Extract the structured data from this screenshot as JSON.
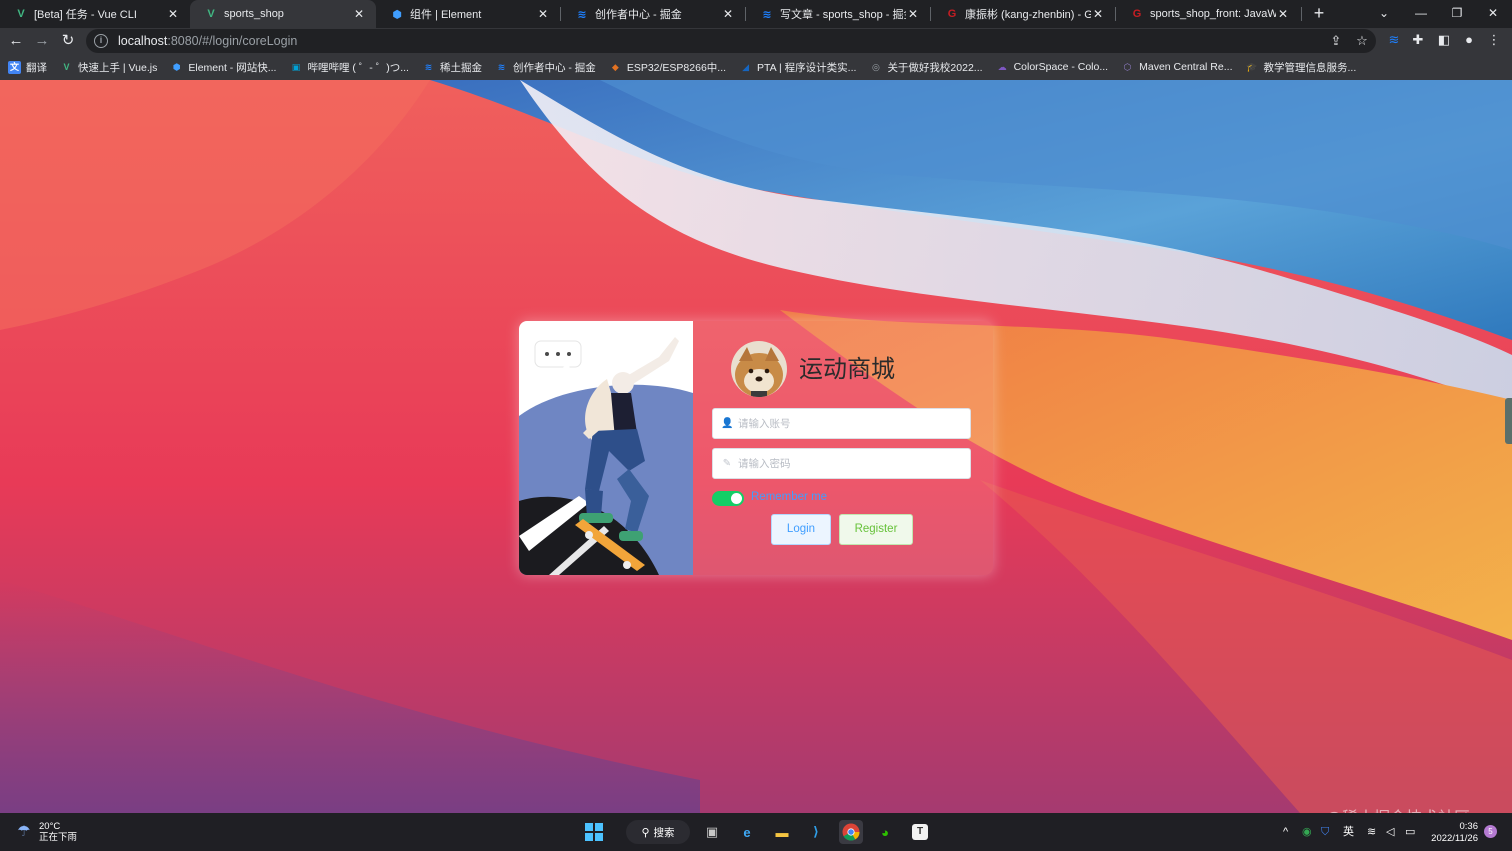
{
  "tabs": [
    {
      "label": "[Beta] 任务 - Vue CLI",
      "fav": "V",
      "fav_color": "#41b883"
    },
    {
      "label": "sports_shop",
      "fav": "V",
      "fav_color": "#41b883"
    },
    {
      "label": "组件 | Element",
      "fav": "⬢",
      "fav_color": "#409eff"
    },
    {
      "label": "创作者中心 - 掘金",
      "fav": "≋",
      "fav_color": "#1e80ff"
    },
    {
      "label": "写文章 - sports_shop - 掘金",
      "fav": "≋",
      "fav_color": "#1e80ff"
    },
    {
      "label": "康振彬 (kang-zhenbin) - Gitee",
      "fav": "G",
      "fav_color": "#c71d23"
    },
    {
      "label": "sports_shop_front: JavaWeb",
      "fav": "G",
      "fav_color": "#c71d23"
    }
  ],
  "tab_close": "✕",
  "new_tab": "+",
  "window_controls": {
    "tab_search": "⌄",
    "minimize": "—",
    "restore": "❐",
    "close": "✕"
  },
  "toolbar": {
    "back": "←",
    "forward": "→",
    "reload": "↻",
    "url_host": "localhost",
    "url_path": ":8080/#/login/coreLogin"
  },
  "bookmarks": [
    {
      "label": "翻译",
      "icon": "文",
      "color": "#4285f4"
    },
    {
      "label": "快速上手 | Vue.js",
      "icon": "V",
      "color": "#41b883"
    },
    {
      "label": "Element - 网站快...",
      "icon": "⬢",
      "color": "#409eff"
    },
    {
      "label": "哔哩哔哩 ( ゜- ゜)つ...",
      "icon": "▣",
      "color": "#00a1d6"
    },
    {
      "label": "稀土掘金",
      "icon": "≋",
      "color": "#1e80ff"
    },
    {
      "label": "创作者中心 - 掘金",
      "icon": "≋",
      "color": "#1e80ff"
    },
    {
      "label": "ESP32/ESP8266中...",
      "icon": "◆",
      "color": "#e37222"
    },
    {
      "label": "PTA | 程序设计类实...",
      "icon": "◢",
      "color": "#1565c0"
    },
    {
      "label": "关于做好我校2022...",
      "icon": "◎",
      "color": "#9aa0a6"
    },
    {
      "label": "ColorSpace - Colo...",
      "icon": "☁",
      "color": "#7e57c2"
    },
    {
      "label": "Maven Central Re...",
      "icon": "⬡",
      "color": "#8e7cc3"
    },
    {
      "label": "教学管理信息服务...",
      "icon": "🎓",
      "color": "#f4b400"
    }
  ],
  "login": {
    "brand": "运动商城",
    "account_placeholder": "请输入账号",
    "password_placeholder": "请输入密码",
    "remember_label": "Remember me",
    "remember_on": true,
    "login_button": "Login",
    "register_button": "Register",
    "bubble": "•••"
  },
  "watermark": "@稀土掘金技术社区",
  "taskbar": {
    "weather_temp": "20°C",
    "weather_desc": "正在下雨",
    "search_label": "搜索",
    "ime": "英",
    "time": "0:36",
    "date": "2022/11/26",
    "notif_count": "5"
  },
  "colors": {
    "accent": "#409eff",
    "success": "#13ce66",
    "register_text": "#67c23a"
  }
}
